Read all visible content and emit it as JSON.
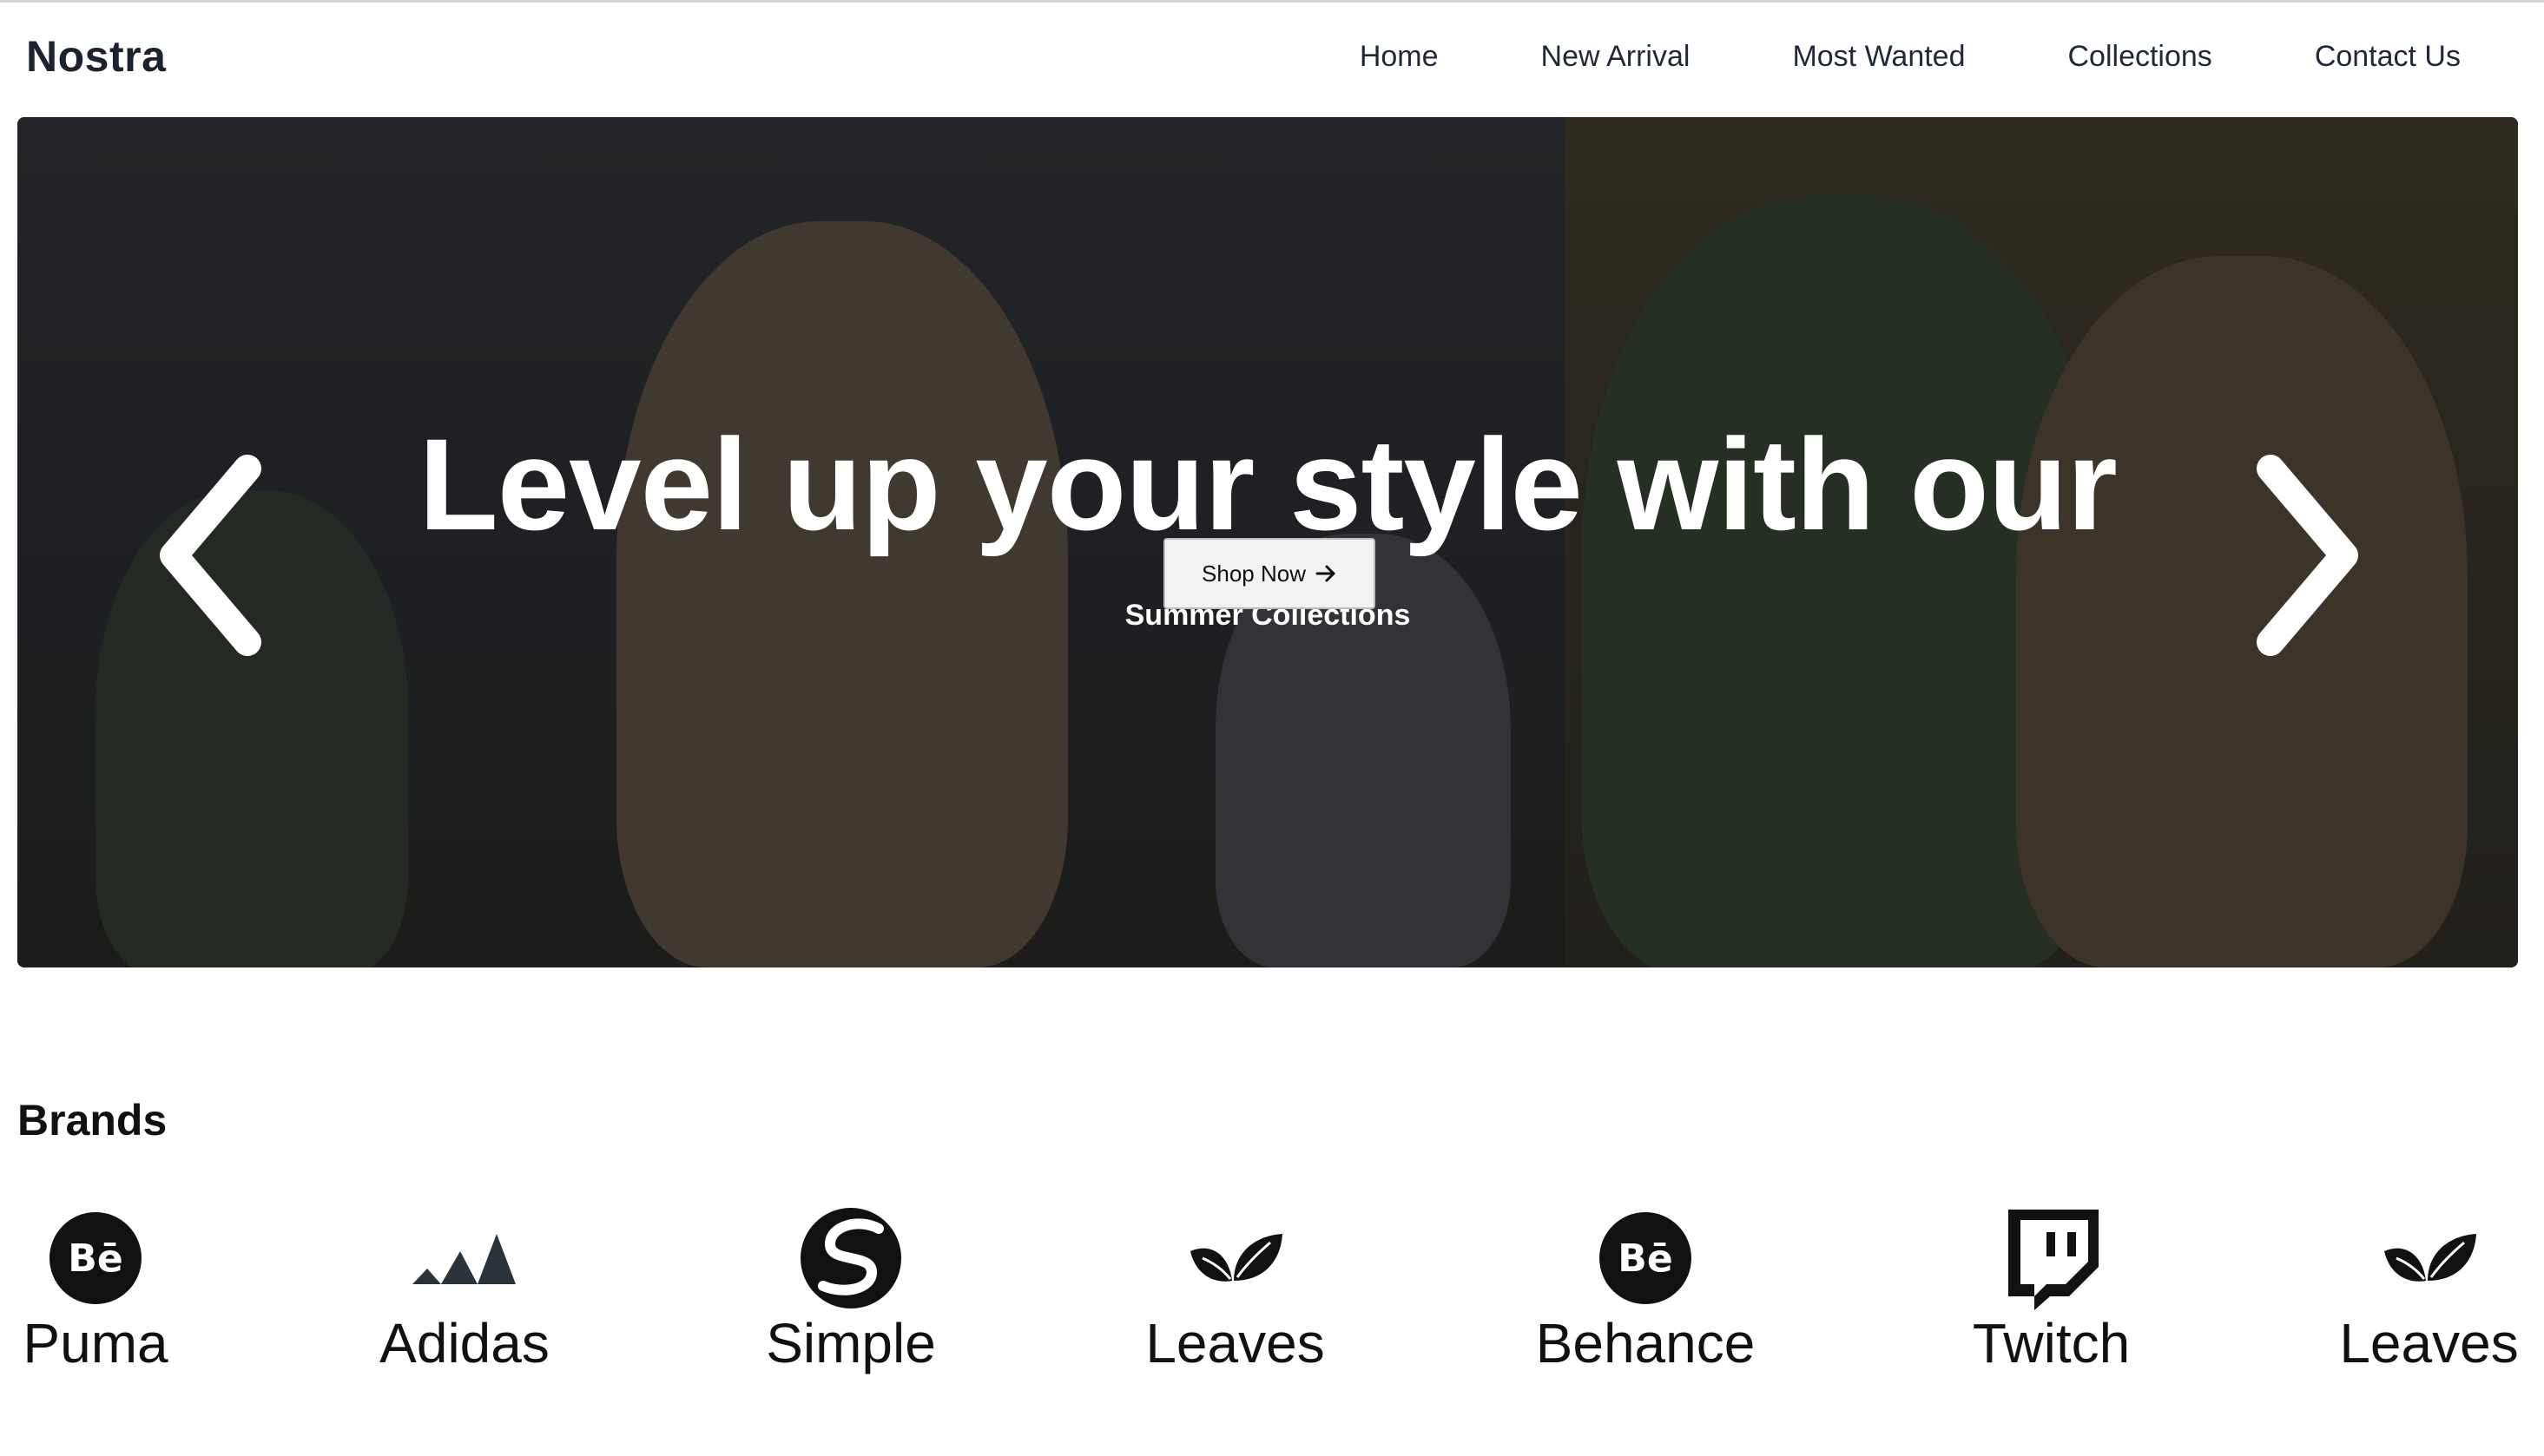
{
  "header": {
    "logo": "Nostra",
    "nav": [
      "Home",
      "New Arrival",
      "Most Wanted",
      "Collections",
      "Contact Us"
    ]
  },
  "hero": {
    "title": "Level up your style with our",
    "subtitle": "Summer Collections",
    "cta_label": "Shop Now",
    "cta_icon": "arrow-right-icon",
    "prev_icon": "chevron-left-icon",
    "next_icon": "chevron-right-icon"
  },
  "brands": {
    "title": "Brands",
    "items": [
      {
        "name": "Puma",
        "icon": "behance-icon"
      },
      {
        "name": "Adidas",
        "icon": "adidas-icon"
      },
      {
        "name": "Simple",
        "icon": "simple-icon"
      },
      {
        "name": "Leaves",
        "icon": "leaves-icon"
      },
      {
        "name": "Behance",
        "icon": "behance-icon"
      },
      {
        "name": "Twitch",
        "icon": "twitch-icon"
      },
      {
        "name": "Leaves",
        "icon": "leaves-icon"
      }
    ]
  },
  "colors": {
    "text": "#111111",
    "button_bg": "#f2f2f2",
    "hero_text": "#ffffff"
  }
}
